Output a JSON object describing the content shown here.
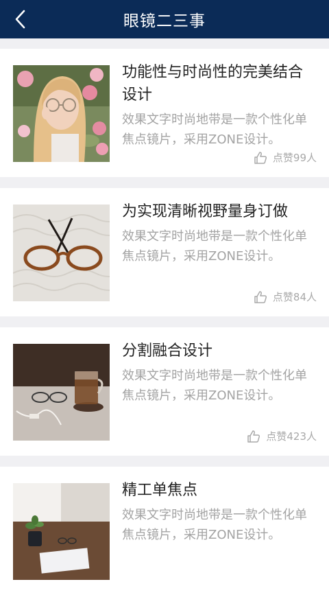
{
  "header": {
    "title": "眼镜二三事",
    "back_icon": "chevron-left-icon",
    "background": "#0b2b57"
  },
  "articles": [
    {
      "title": "功能性与时尚性的完美结合设计",
      "description": "效果文字时尚地带是一款个性化单焦点镜片，采用ZONE设计。",
      "likes": "点赞99人",
      "image": "woman-with-glasses-photo"
    },
    {
      "title": "为实现清晰视野量身订做",
      "description": "效果文字时尚地带是一款个性化单焦点镜片，采用ZONE设计。",
      "likes": "点赞84人",
      "image": "tortoiseshell-glasses-photo"
    },
    {
      "title": "分割融合设计",
      "description": "效果文字时尚地带是一款个性化单焦点镜片，采用ZONE设计。",
      "likes": "点赞423人",
      "image": "tea-cup-and-glasses-photo"
    },
    {
      "title": "精工单焦点",
      "description": "效果文字时尚地带是一款个性化单焦点镜片，采用ZONE设计。",
      "likes": "",
      "image": "desk-with-plant-photo"
    }
  ],
  "colors": {
    "title_text": "#222222",
    "secondary_text": "#a3a3a3",
    "separator": "#f0f0f3"
  },
  "like_icon": "thumbs-up-icon"
}
